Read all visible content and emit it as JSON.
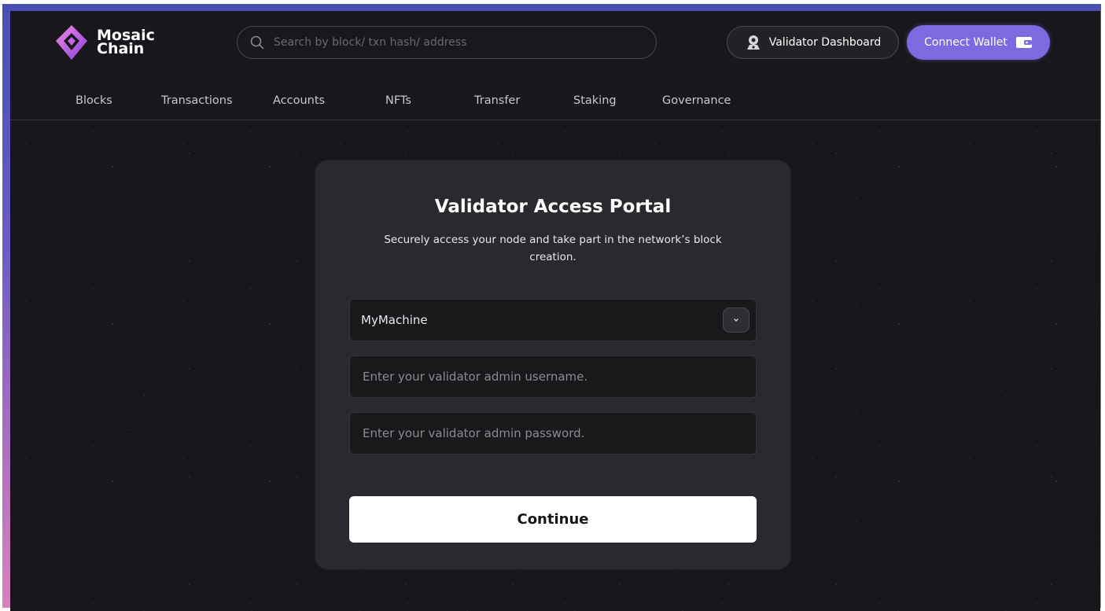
{
  "brand": {
    "line1": "Mosaic",
    "line2": "Chain"
  },
  "search": {
    "placeholder": "Search by block/ txn hash/ address"
  },
  "header": {
    "validator_dashboard_label": "Validator Dashboard",
    "connect_wallet_label": "Connect Wallet"
  },
  "nav": {
    "items": [
      {
        "label": "Blocks"
      },
      {
        "label": "Transactions"
      },
      {
        "label": "Accounts"
      },
      {
        "label": "NFTs"
      },
      {
        "label": "Transfer"
      },
      {
        "label": "Staking"
      },
      {
        "label": "Governance"
      }
    ]
  },
  "portal": {
    "title": "Validator Access Portal",
    "subtitle": "Securely access your node and take part in the network’s block creation.",
    "machine_select_value": "MyMachine",
    "username_placeholder": "Enter your validator admin username.",
    "password_placeholder": "Enter your validator admin password.",
    "continue_label": "Continue"
  },
  "colors": {
    "accent": "#7d6ae0",
    "background": "#18161b",
    "card": "#2b292e",
    "frame_top": "#4a4fb4",
    "frame_bottom": "#d982bc"
  },
  "icons": {
    "logo": "mosaic-diamond-logo",
    "search": "search-icon",
    "validator": "validator-person-icon",
    "wallet": "wallet-icon",
    "dropdown": "chevron-down-icon"
  }
}
